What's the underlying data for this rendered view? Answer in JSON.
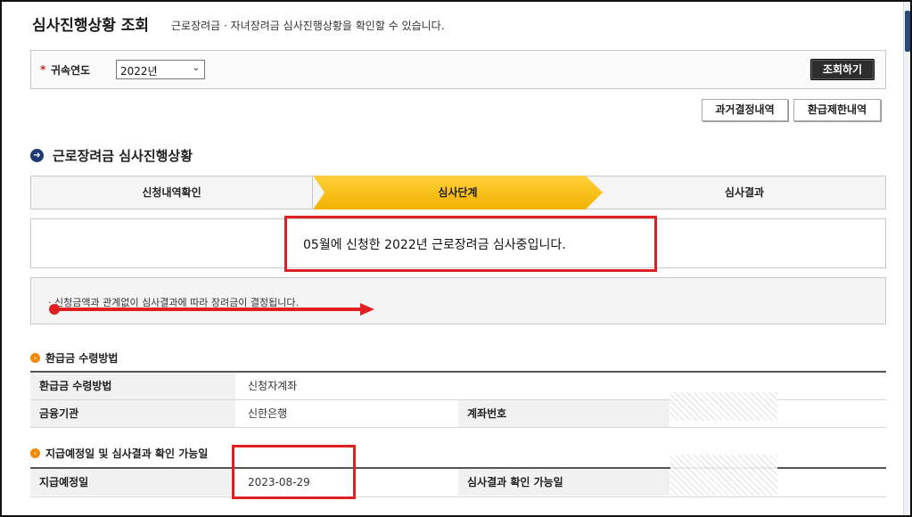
{
  "header": {
    "title": "심사진행상황 조회",
    "subtitle": "근로장려금 · 자녀장려금 심사진행상황을 확인할 수 있습니다."
  },
  "search": {
    "required_mark": "*",
    "year_label": "귀속연도",
    "year_value": "2022년",
    "query_button": "조회하기"
  },
  "actions": {
    "past_decisions": "과거결정내역",
    "refund_limits": "환급제한내역"
  },
  "progress_section": {
    "title": "근로장려금 심사진행상황",
    "steps": [
      "신청내역확인",
      "심사단계",
      "심사결과"
    ],
    "active_step": 1,
    "message": "05월에 신청한 2022년 근로장려금 심사중입니다.",
    "note": "· 신청금액과 관계없이 심사결과에 따라 장려금이 결정됩니다."
  },
  "refund_method": {
    "title": "환급금 수령방법",
    "method_label": "환급금 수령방법",
    "method_value": "신청자계좌",
    "bank_label": "금융기관",
    "bank_value": "신한은행",
    "account_label": "계좌번호"
  },
  "schedule": {
    "title": "지급예정일 및 심사결과 확인 가능일",
    "pay_date_label": "지급예정일",
    "pay_date_value": "2023-08-29",
    "result_date_label": "심사결과 확인 가능일"
  },
  "colors": {
    "active_step": "#f7c11e",
    "highlight_red": "#e02020",
    "query_button_bg": "#2d2d2d",
    "section_icon_blue": "#1d3c6d",
    "section_icon_orange": "#f08a00"
  }
}
